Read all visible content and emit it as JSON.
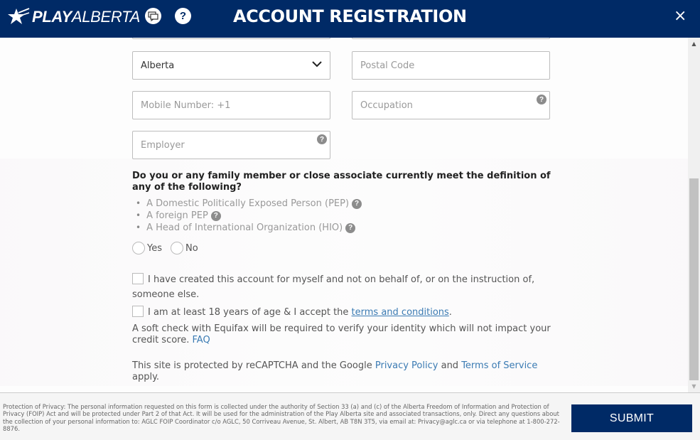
{
  "header": {
    "logo_bold": "PLAY",
    "logo_light": "ALBERTA",
    "title": "ACCOUNT REGISTRATION",
    "chat_icon": "chat-icon",
    "help_label": "?",
    "close_label": "×"
  },
  "form": {
    "province": {
      "value": "Alberta"
    },
    "postal_code": {
      "placeholder": "Postal Code"
    },
    "mobile": {
      "placeholder": "Mobile Number: +1"
    },
    "occupation": {
      "placeholder": "Occupation"
    },
    "employer": {
      "placeholder": "Employer"
    },
    "help_glyph": "?",
    "pep_question": "Do you or any family member or close associate currently meet the definition of any of the following?",
    "pep_items": [
      "A Domestic Politically Exposed Person (PEP)",
      "A foreign PEP",
      "A Head of International Organization (HIO)"
    ],
    "radio_yes": "Yes",
    "radio_no": "No",
    "check_self": "I have created this account for myself and not on behalf of, or on the instruction of, someone else.",
    "check_age_prefix": "I am at least 18 years of age & I accept the ",
    "check_age_link": "terms and conditions",
    "check_age_suffix": ".",
    "equifax_text": "A soft check with Equifax will be required to verify your identity which will not impact your credit score. ",
    "faq_link": "FAQ",
    "recaptcha_prefix": "This site is protected by reCAPTCHA and the Google ",
    "privacy_link": "Privacy Policy",
    "recaptcha_and": " and ",
    "tos_link": "Terms of Service",
    "recaptcha_suffix": " apply."
  },
  "footer": {
    "privacy_notice": "Protection of Privacy: The personal information requested on this form is collected under the authority of Section 33 (a) and (c) of the Alberta Freedom of Information and Protection of Privacy (FOIP) Act and will be protected under Part 2 of that Act. It will be used for the administration of the Play Alberta site and associated transactions, only. Direct any questions about the collection of your personal information to: AGLC FOIP Coordinator c/o AGLC, 50 Corriveau Avenue, St. Albert, AB T8N 3T5, via email at: Privacy@aglc.ca or via telephone at 1-800-272-8876.",
    "submit_label": "SUBMIT"
  },
  "colors": {
    "brand_navy": "#002a66",
    "link_blue": "#3b7bb3"
  }
}
